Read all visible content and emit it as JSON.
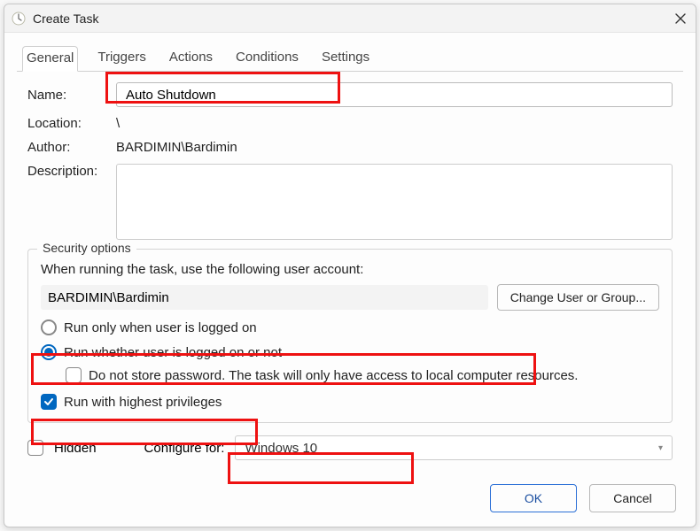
{
  "titlebar": {
    "title": "Create Task"
  },
  "tabs": {
    "general": "General",
    "triggers": "Triggers",
    "actions": "Actions",
    "conditions": "Conditions",
    "settings": "Settings"
  },
  "form": {
    "name_label": "Name:",
    "name_value": "Auto Shutdown",
    "location_label": "Location:",
    "location_value": "\\",
    "author_label": "Author:",
    "author_value": "BARDIMIN\\Bardimin",
    "description_label": "Description:"
  },
  "security": {
    "legend": "Security options",
    "prompt": "When running the task, use the following user account:",
    "account": "BARDIMIN\\Bardimin",
    "change_btn": "Change User or Group...",
    "radio_logged_on": "Run only when user is logged on",
    "radio_whether": "Run whether user is logged on or not",
    "no_store_pw": "Do not store password.  The task will only have access to local computer resources.",
    "run_highest": "Run with highest privileges"
  },
  "bottom": {
    "hidden_label": "Hidden",
    "configure_label": "Configure for:",
    "configure_value": "Windows 10"
  },
  "buttons": {
    "ok": "OK",
    "cancel": "Cancel"
  }
}
